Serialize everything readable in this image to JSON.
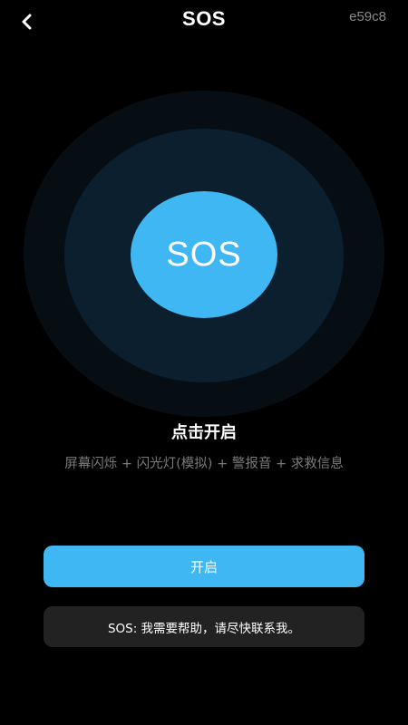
{
  "header": {
    "title": "SOS",
    "code": "e59c8"
  },
  "sos_button": {
    "label": "SOS"
  },
  "tap_label": "点击开启",
  "description": "屏幕闪烁 + 闪光灯(模拟) + 警报音 + 求救信息",
  "start_button": {
    "label": "开启"
  },
  "message": {
    "text": "SOS: 我需要帮助，请尽快联系我。"
  },
  "colors": {
    "accent": "#3fb7f2",
    "background": "#000000",
    "ring_outer": "#060e14",
    "ring_middle": "#0c1f2e",
    "message_bg": "#222222",
    "muted_text": "#7a7a7a"
  },
  "icons": {
    "back": "chevron-left-icon"
  }
}
